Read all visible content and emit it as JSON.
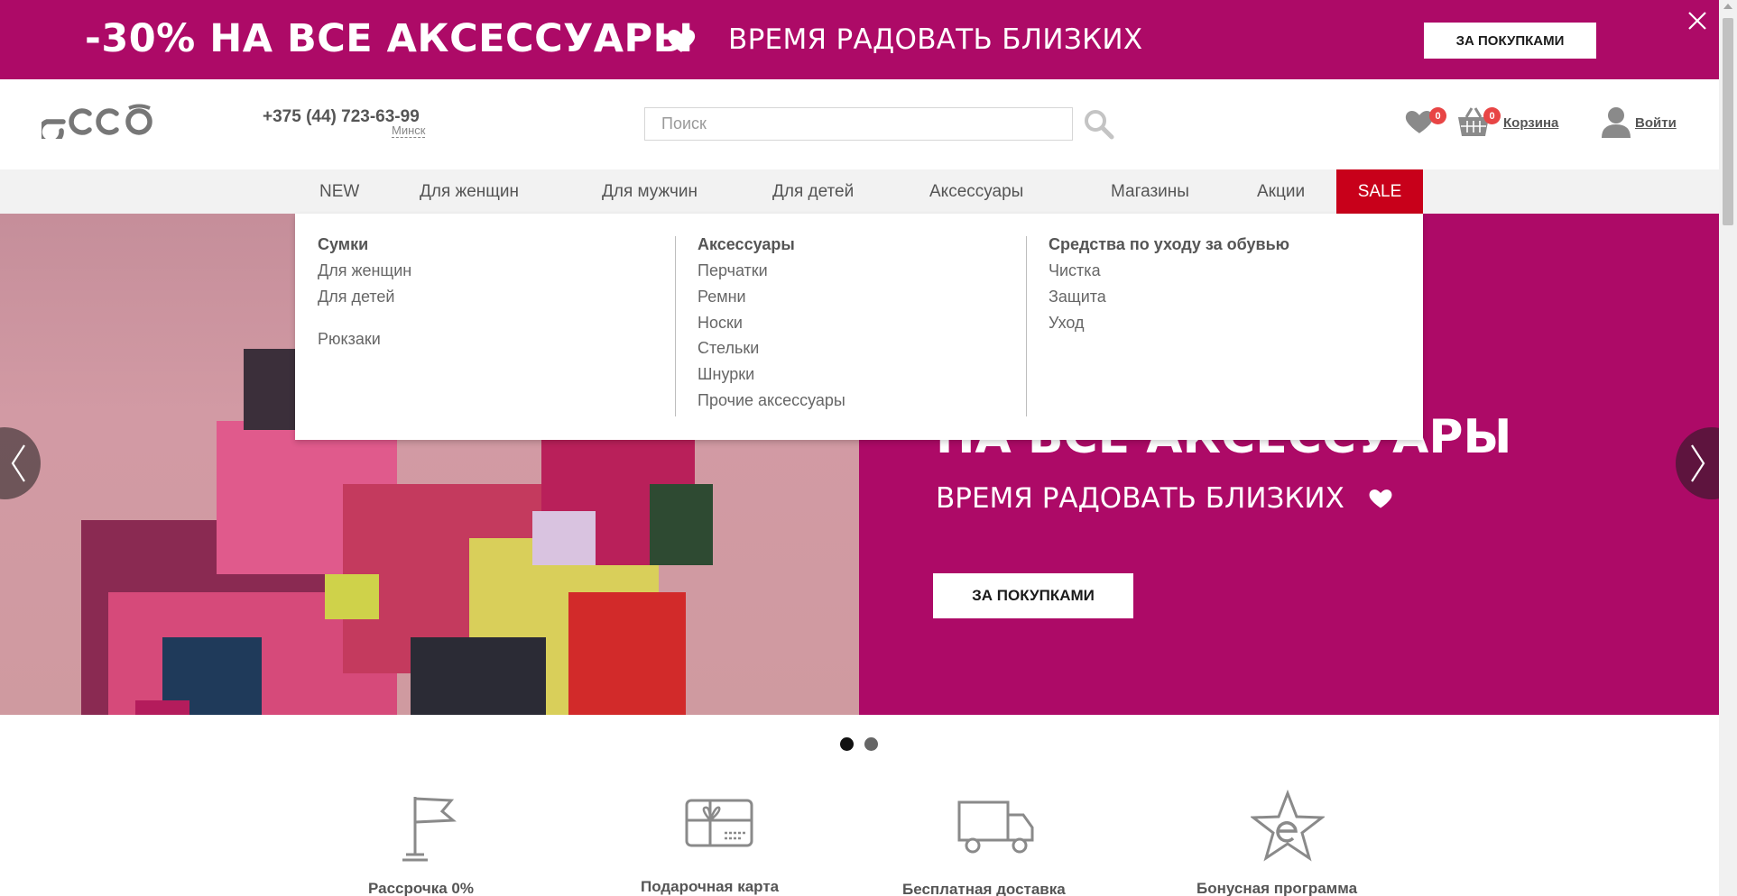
{
  "promo": {
    "headline": "-30% НА ВСЕ АКСЕССУАРЫ",
    "subline": "ВРЕМЯ РАДОВАТЬ БЛИЗКИХ",
    "button_label": "ЗА ПОКУПКАМИ",
    "background_color": "#ad0a67"
  },
  "header": {
    "logo": "ecco",
    "phone": "+375 (44) 723-63-99",
    "city": "Минск",
    "search_placeholder": "Поиск",
    "wishlist_count": "0",
    "cart_count": "0",
    "cart_label": "Корзина",
    "login_label": "Войти"
  },
  "nav": {
    "items": [
      "NEW",
      "Для женщин",
      "Для мужчин",
      "Для детей",
      "Аксессуары",
      "Магазины",
      "Акции"
    ],
    "sale_label": "SALE",
    "sale_color": "#c8001a"
  },
  "mega_menu": {
    "columns": [
      {
        "heading": "Сумки",
        "links": [
          "Для женщин",
          "Для детей",
          "Рюкзаки"
        ]
      },
      {
        "heading": "Аксессуары",
        "links": [
          "Перчатки",
          "Ремни",
          "Носки",
          "Стельки",
          "Шнурки",
          "Прочие аксессуары"
        ]
      },
      {
        "heading": "Средства по уходу за обувью",
        "links": [
          "Чистка",
          "Защита",
          "Уход"
        ]
      }
    ]
  },
  "hero": {
    "title": "НА ВСЕ АКСЕССУАРЫ",
    "subtitle": "ВРЕМЯ РАДОВАТЬ БЛИЗКИХ",
    "button_label": "ЗА ПОКУПКАМИ",
    "active_slide": 1,
    "slide_count": 2
  },
  "features": [
    {
      "label": "Рассрочка 0%",
      "icon": "flag-icon"
    },
    {
      "label": "Подарочная карта",
      "icon": "gift-card-icon"
    },
    {
      "label": "Бесплатная доставка",
      "icon": "truck-icon"
    },
    {
      "label": "Бонусная программа",
      "icon": "star-icon"
    }
  ]
}
